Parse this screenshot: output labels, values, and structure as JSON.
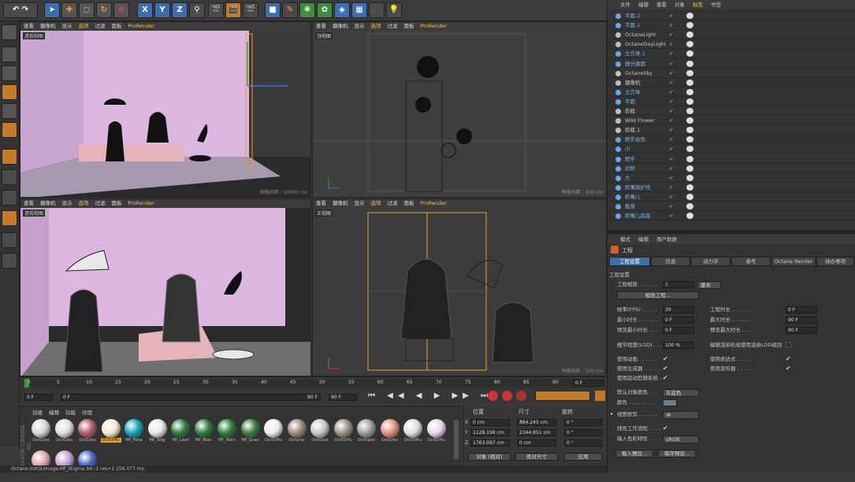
{
  "toolbar": {
    "axis_x": "X",
    "axis_y": "Y",
    "axis_z": "Z"
  },
  "viewports": {
    "menu": [
      "查看",
      "摄像机",
      "显示",
      "选项",
      "过滤",
      "面板",
      "ProRender"
    ],
    "tl": {
      "name": "透视视图",
      "footer": "网格间距 : 10000 cm"
    },
    "tr": {
      "name": "顶视图",
      "footer": "网格间距 : 100 cm"
    },
    "bl": {
      "name": "透视视图",
      "footer": ""
    },
    "br": {
      "name": "正视图",
      "footer": "网格间距 : 100 cm"
    }
  },
  "timeline": {
    "ticks": [
      "0",
      "5",
      "10",
      "15",
      "20",
      "25",
      "30",
      "35",
      "40",
      "45",
      "50",
      "55",
      "60",
      "65",
      "70",
      "75",
      "80",
      "85",
      "90"
    ],
    "start": "0 F",
    "current": "0 F",
    "end": "90 F",
    "end2": "90 F",
    "end_field": "90 F",
    "frame_right": "0 F"
  },
  "materials": {
    "menu": [
      "创建",
      "编辑",
      "功能",
      "纹理"
    ],
    "items": [
      {
        "label": "OctGlos",
        "color": "#d6d6d6"
      },
      {
        "label": "OctGlos",
        "color": "#e0e0e0"
      },
      {
        "label": "OctGlos",
        "color": "#b05c6c"
      },
      {
        "label": "OctDiffu",
        "color": "#f5e9d0"
      },
      {
        "label": "Mf_Peta",
        "color": "#16a3b4"
      },
      {
        "label": "Mf_Stig",
        "color": "#e6e6e6"
      },
      {
        "label": "Mf_Leaf",
        "color": "#2f7a3a"
      },
      {
        "label": "Mf_Blac",
        "color": "#2b7a3a"
      },
      {
        "label": "Mf_Sten",
        "color": "#2c7f3b"
      },
      {
        "label": "Mf_Gras",
        "color": "#3c7b3f"
      },
      {
        "label": "OctDiffu",
        "color": "#ececec"
      },
      {
        "label": "Octane",
        "color": "#9a8a78"
      },
      {
        "label": "OctGlos",
        "color": "#c8c8c8"
      },
      {
        "label": "OctDiffu",
        "color": "#9a8f86"
      },
      {
        "label": "OctSpec",
        "color": "#9c9c9c"
      },
      {
        "label": "OctGlos",
        "color": "#e2927c"
      },
      {
        "label": "OctDiffu",
        "color": "#dedede"
      },
      {
        "label": "OctDiffu",
        "color": "#e9d7e9"
      },
      {
        "label": "",
        "color": "#e3a6b0"
      },
      {
        "label": "",
        "color": "#c4a6d4"
      },
      {
        "label": "",
        "color": "#4a6ac8"
      }
    ],
    "maxon": "MAXON CINEMA 4D"
  },
  "coords": {
    "headers": [
      "位置",
      "尺寸",
      "旋转"
    ],
    "x": "0 cm",
    "y": "1128.156 cm",
    "z": "1763.097 cm",
    "sx": "884.245 cm",
    "sy": "2344.851 cm",
    "sz": "0 cm",
    "h": "0 °",
    "p": "0 °",
    "b": "0 °",
    "mode1": "对象 (相对)",
    "mode2": "绝对尺寸",
    "apply": "应用"
  },
  "object_manager": {
    "menu": [
      "文件",
      "编辑",
      "查看",
      "对象",
      "标签",
      "书签"
    ],
    "rows": [
      {
        "name": "平面.2",
        "highlight": true
      },
      {
        "name": "平面.1",
        "highlight": true
      },
      {
        "name": "OctaneLight"
      },
      {
        "name": "OctaneDayLight"
      },
      {
        "name": "立方体.1",
        "highlight": true
      },
      {
        "name": "细分曲面",
        "highlight": true
      },
      {
        "name": "OctaneSky"
      },
      {
        "name": "摄像机"
      },
      {
        "name": "立方体",
        "highlight": true
      },
      {
        "name": "平面",
        "highlight": true
      },
      {
        "name": "奶瓶"
      },
      {
        "name": "Wild Flower"
      },
      {
        "name": "奶瓶.1"
      },
      {
        "name": "把手由色",
        "highlight": true
      },
      {
        "name": "小",
        "highlight": true
      },
      {
        "name": "把手",
        "highlight": true
      },
      {
        "name": "对称",
        "highlight": true
      },
      {
        "name": "大",
        "highlight": true
      },
      {
        "name": "奶嘴保护壳",
        "highlight": true
      },
      {
        "name": "奶嘴儿",
        "highlight": true
      },
      {
        "name": "瓶身",
        "highlight": true
      },
      {
        "name": "奶嘴儿底座",
        "highlight": true
      }
    ]
  },
  "attributes": {
    "menu": [
      "模式",
      "编辑",
      "用户数据"
    ],
    "title": "工程",
    "tabs": [
      "工程设置",
      "信息",
      "动力学",
      "参考",
      "Octane Render",
      "待办事项"
    ],
    "section": "工程设置",
    "scale_label": "工程缩放 . . . . . .",
    "scale_value": "1",
    "scale_unit": "厘米",
    "scale_btn": "缩放工程...",
    "fps_label": "帧率(FPS) . . . . .",
    "fps": "30",
    "time_label": "工程时长 . . . . . .",
    "time": "0 F",
    "min_label": "最小时长 . . . . . .",
    "min": "0 F",
    "max_label": "最大时长 . . . . . .",
    "max": "90 F",
    "pmin_label": "预览最小时长 . . .",
    "pmin": "0 F",
    "pmax_label": "预览最大时长 . . .",
    "pmax": "90 F",
    "lod_label": "细节程度(LOD) . . .",
    "lod": "100 %",
    "lod_editor": "编辑渲染检视使用渲染LOD级别",
    "anim": "使用动画 . . . . . .",
    "expr": "使用表达式 . . . . .",
    "gen": "使用生成器 . . . . .",
    "deform": "使用变形器 . . . . .",
    "motion": "使用运动剪辑系统 . .",
    "defcolor_label": "默认对象颜色 . . .",
    "defcolor": "灰蓝色",
    "color_label": "颜色 . . . . . . . .",
    "clip_label": "视图修剪 . . . . . .",
    "clip": "中",
    "linear_label": "线性工作流程 . . . .",
    "input_label": "输入色彩特性 . . . .",
    "input": "sRGB",
    "load_btn": "载入预设...",
    "save_btn": "保存预设..."
  },
  "status": "Octane:InitGLImage:Mf_Stigma  bit:-1 res=1  156.077 ms."
}
